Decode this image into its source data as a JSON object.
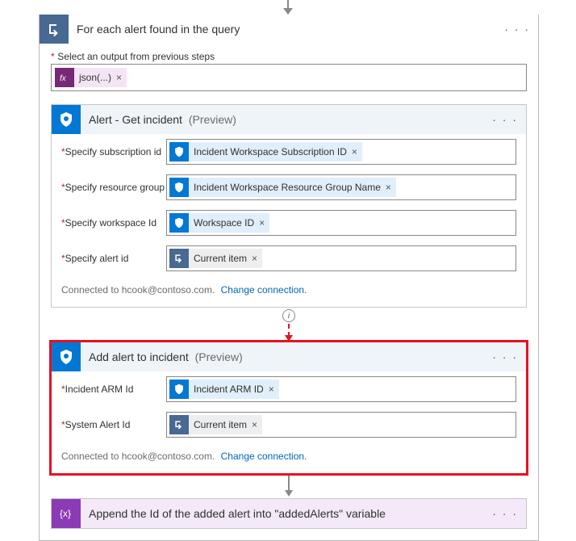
{
  "outer": {
    "title": "For each alert found in the query",
    "select_label": "Select an output from previous steps",
    "json_pill": "json(...)",
    "close_x": "×"
  },
  "get_incident": {
    "title": "Alert - Get incident",
    "preview": "(Preview)",
    "fields": {
      "sub_label": "Specify subscription id",
      "sub_pill": "Incident Workspace Subscription ID",
      "rg_label": "Specify resource group",
      "rg_pill": "Incident Workspace Resource Group Name",
      "ws_label": "Specify workspace Id",
      "ws_pill": "Workspace ID",
      "alert_label": "Specify alert id",
      "alert_pill": "Current item"
    },
    "connected": "Connected to hcook@contoso.com.",
    "change": "Change connection."
  },
  "add_alert": {
    "title": "Add alert to incident",
    "preview": "(Preview)",
    "fields": {
      "arm_label": "Incident ARM Id",
      "arm_pill": "Incident ARM ID",
      "sys_label": "System Alert Id",
      "sys_pill": "Current item"
    },
    "connected": "Connected to hcook@contoso.com.",
    "change": "Change connection."
  },
  "append": {
    "title": "Append the Id of the added alert into \"addedAlerts\" variable"
  },
  "menu": "· · ·",
  "info": "i"
}
